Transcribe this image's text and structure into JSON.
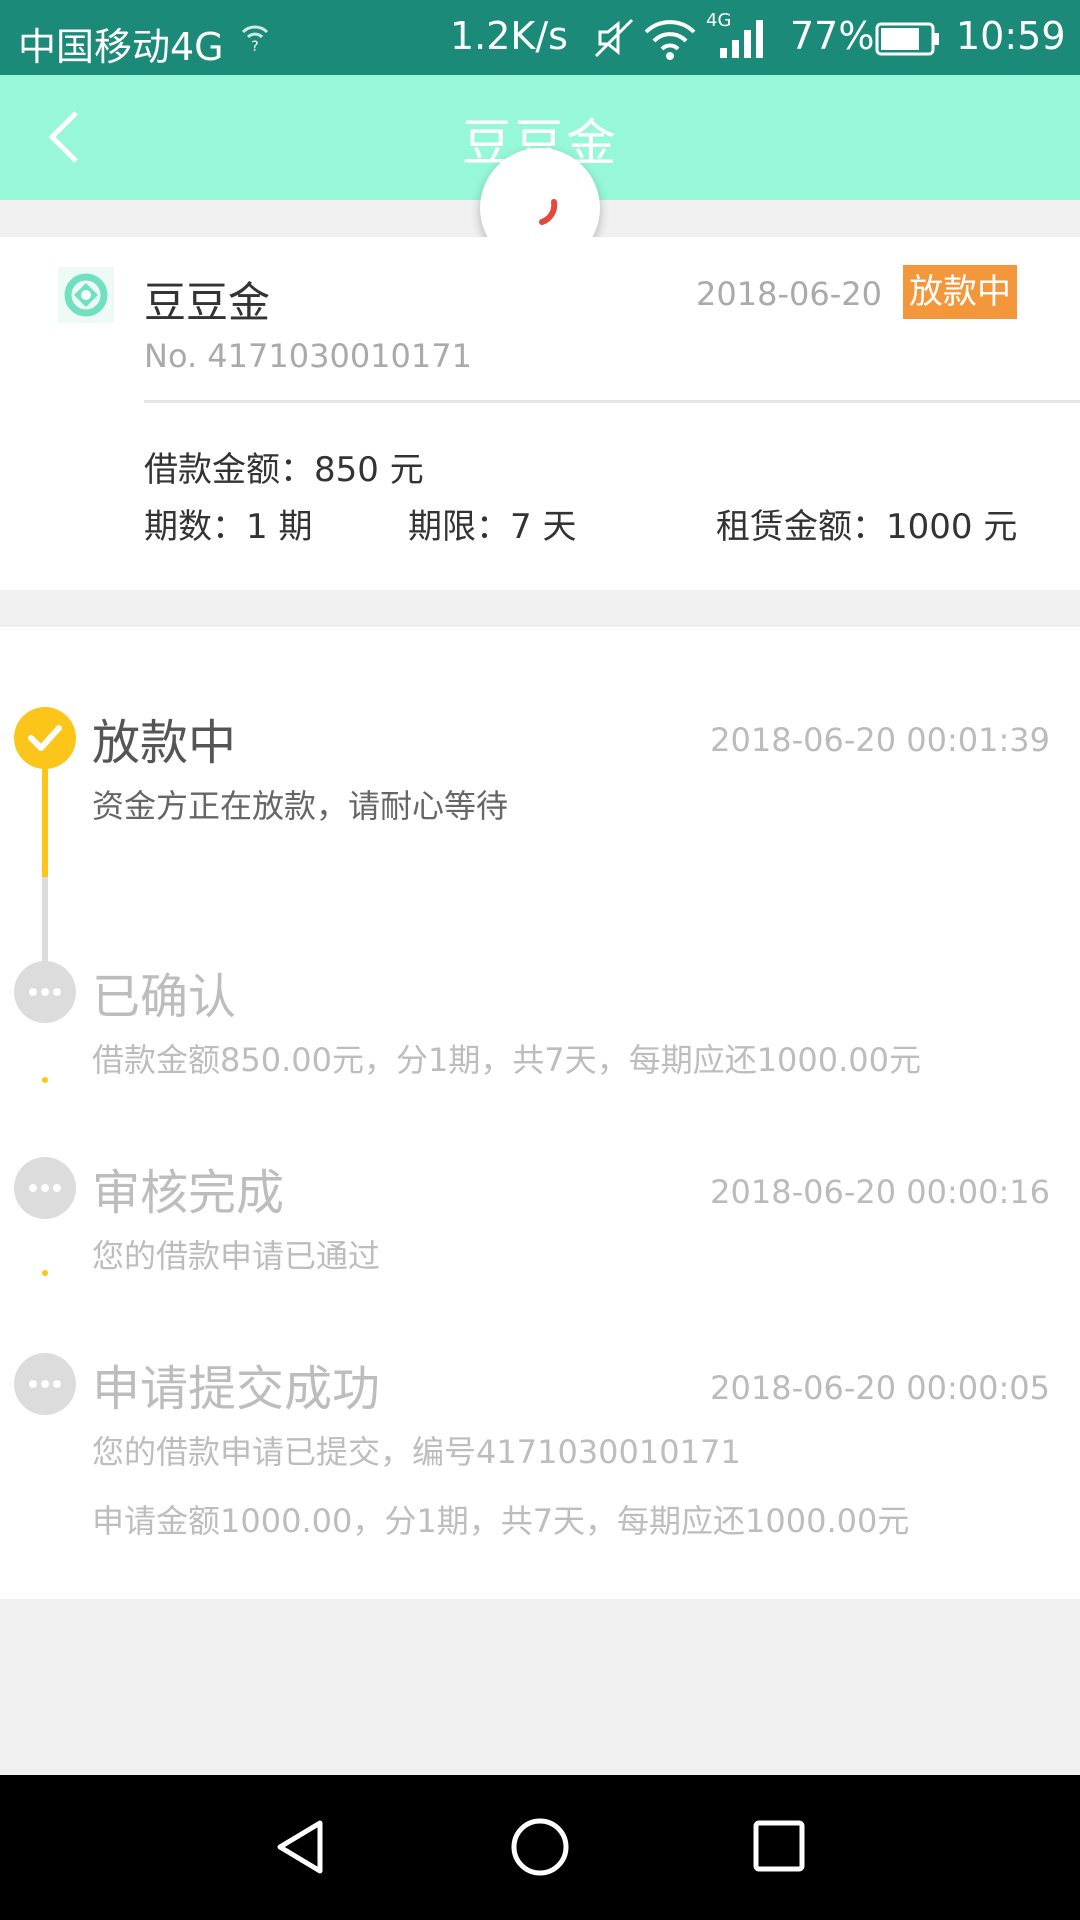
{
  "status_bar": {
    "carrier": "中国移动4G",
    "speed": "1.2K/s",
    "network_label": "4G",
    "battery_percent": "77%",
    "time": "10:59",
    "icons": [
      "wifi-question-icon",
      "mute-icon",
      "wifi-icon",
      "signal-icon",
      "battery-icon"
    ]
  },
  "header": {
    "title": "豆豆金",
    "back_icon": "chevron-left-icon"
  },
  "loan_card": {
    "name": "豆豆金",
    "date": "2018-06-20",
    "status_badge": "放款中",
    "number": "No. 4171030010171",
    "loan_amount": "借款金额：850 元",
    "periods": "期数：1 期",
    "term": "期限：7 天",
    "lease_amount": "租赁金额：1000 元"
  },
  "timeline": [
    {
      "title": "放款中",
      "time": "2018-06-20 00:01:39",
      "desc": [
        "资金方正在放款，请耐心等待"
      ],
      "state": "done"
    },
    {
      "title": "已确认",
      "time": "",
      "desc": [
        "借款金额850.00元，分1期，共7天，每期应还1000.00元"
      ],
      "state": "pending"
    },
    {
      "title": "审核完成",
      "time": "2018-06-20 00:00:16",
      "desc": [
        "您的借款申请已通过"
      ],
      "state": "pending"
    },
    {
      "title": "申请提交成功",
      "time": "2018-06-20 00:00:05",
      "desc": [
        "您的借款申请已提交，编号4171030010171",
        "申请金额1000.00，分1期，共7天，每期应还1000.00元"
      ],
      "state": "pending"
    }
  ],
  "colors": {
    "status_bar": "#1b8a79",
    "header": "#96f8d8",
    "badge": "#f4973b",
    "timeline_done": "#fbc619",
    "timeline_pending": "#dcdcdc"
  },
  "navigation": {
    "icons": [
      "nav-back-icon",
      "nav-home-icon",
      "nav-recent-icon"
    ]
  }
}
